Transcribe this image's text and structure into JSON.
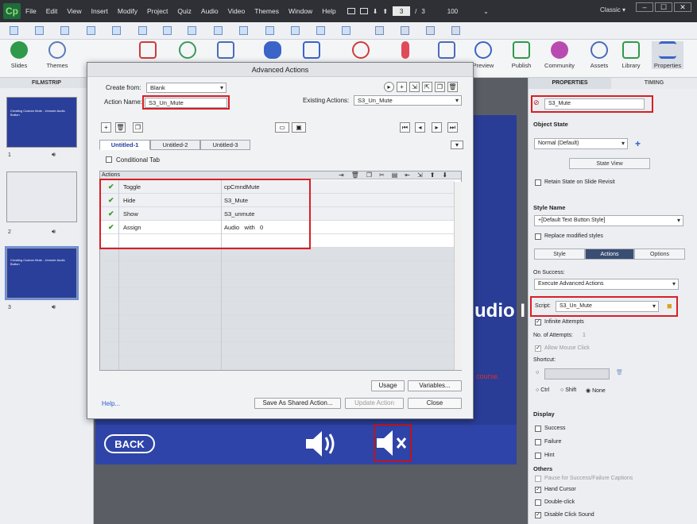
{
  "menubar": {
    "logo": "Cp",
    "items": [
      "File",
      "Edit",
      "View",
      "Insert",
      "Modify",
      "Project",
      "Quiz",
      "Audio",
      "Video",
      "Themes",
      "Window",
      "Help"
    ],
    "page_current": "3",
    "page_sep": "/",
    "page_total": "3",
    "zoom": "100",
    "workspace": "Classic"
  },
  "toolbar": {
    "slides": "Slides",
    "themes": "Themes",
    "preview": "Preview",
    "publish": "Publish",
    "community": "Community",
    "assets": "Assets",
    "library": "Library",
    "properties": "Properties"
  },
  "filmstrip": {
    "title": "FILMSTRIP",
    "slide1_title": "Creating Custom Mute - Unmute Audio Button",
    "slide3_title": "Creating Custom Mute - Unmute Audio Button",
    "numbers": [
      "1",
      "2",
      "3"
    ]
  },
  "stage": {
    "back_label": "BACK",
    "audio_text": "udio I",
    "red_text": "course."
  },
  "dialog": {
    "title": "Advanced Actions",
    "create_from_label": "Create from:",
    "create_from_value": "Blank",
    "action_name_label": "Action Name:",
    "action_name_value": "S3_Un_Mute",
    "existing_label": "Existing Actions:",
    "existing_value": "S3_Un_Mute",
    "tabs": [
      "Untitled-1",
      "Untitled-2",
      "Untitled-3"
    ],
    "conditional_tab": "Conditional Tab",
    "actions_header": "Actions",
    "rows": [
      {
        "action": "Toggle",
        "target": "cpCmndMute"
      },
      {
        "action": "Hide",
        "target": "S3_Mute"
      },
      {
        "action": "Show",
        "target": "S3_unmute"
      },
      {
        "action": "Assign",
        "target": "Audio   with   0"
      }
    ],
    "usage": "Usage",
    "variables": "Variables...",
    "help": "Help...",
    "save_shared": "Save As Shared Action...",
    "update_action": "Update Action",
    "close": "Close"
  },
  "rpanel": {
    "tab_properties": "PROPERTIES",
    "tab_timing": "TIMING",
    "object_name": "S3_Mute",
    "object_state": "Object State",
    "state_value": "Normal (Default)",
    "state_view": "State View",
    "retain_state": "Retain State on Slide Revisit",
    "style_name": "Style Name",
    "style_value": "+[Default Text Button Style]",
    "replace_styles": "Replace modified styles",
    "seg_style": "Style",
    "seg_actions": "Actions",
    "seg_options": "Options",
    "on_success": "On Success:",
    "on_success_value": "Execute Advanced Actions",
    "script_label": "Script:",
    "script_value": "S3_Un_Mute",
    "infinite_attempts": "Infinite Attempts",
    "attempts_label": "No. of Attempts:",
    "attempts_value": "1",
    "allow_mouse": "Allow Mouse Click",
    "shortcut": "Shortcut:",
    "ctrl": "Ctrl",
    "shift": "Shift",
    "none": "None",
    "display": "Display",
    "success": "Success",
    "failure": "Failure",
    "hint": "Hint",
    "others": "Others",
    "pause": "Pause for Success/Failure Captions",
    "hand_cursor": "Hand Cursor",
    "double_click": "Double-click",
    "disable_sound": "Disable Click Sound"
  },
  "colors": {
    "accent": "#2a3d96",
    "highlight": "#d81f26",
    "check": "#3a9a2a"
  }
}
